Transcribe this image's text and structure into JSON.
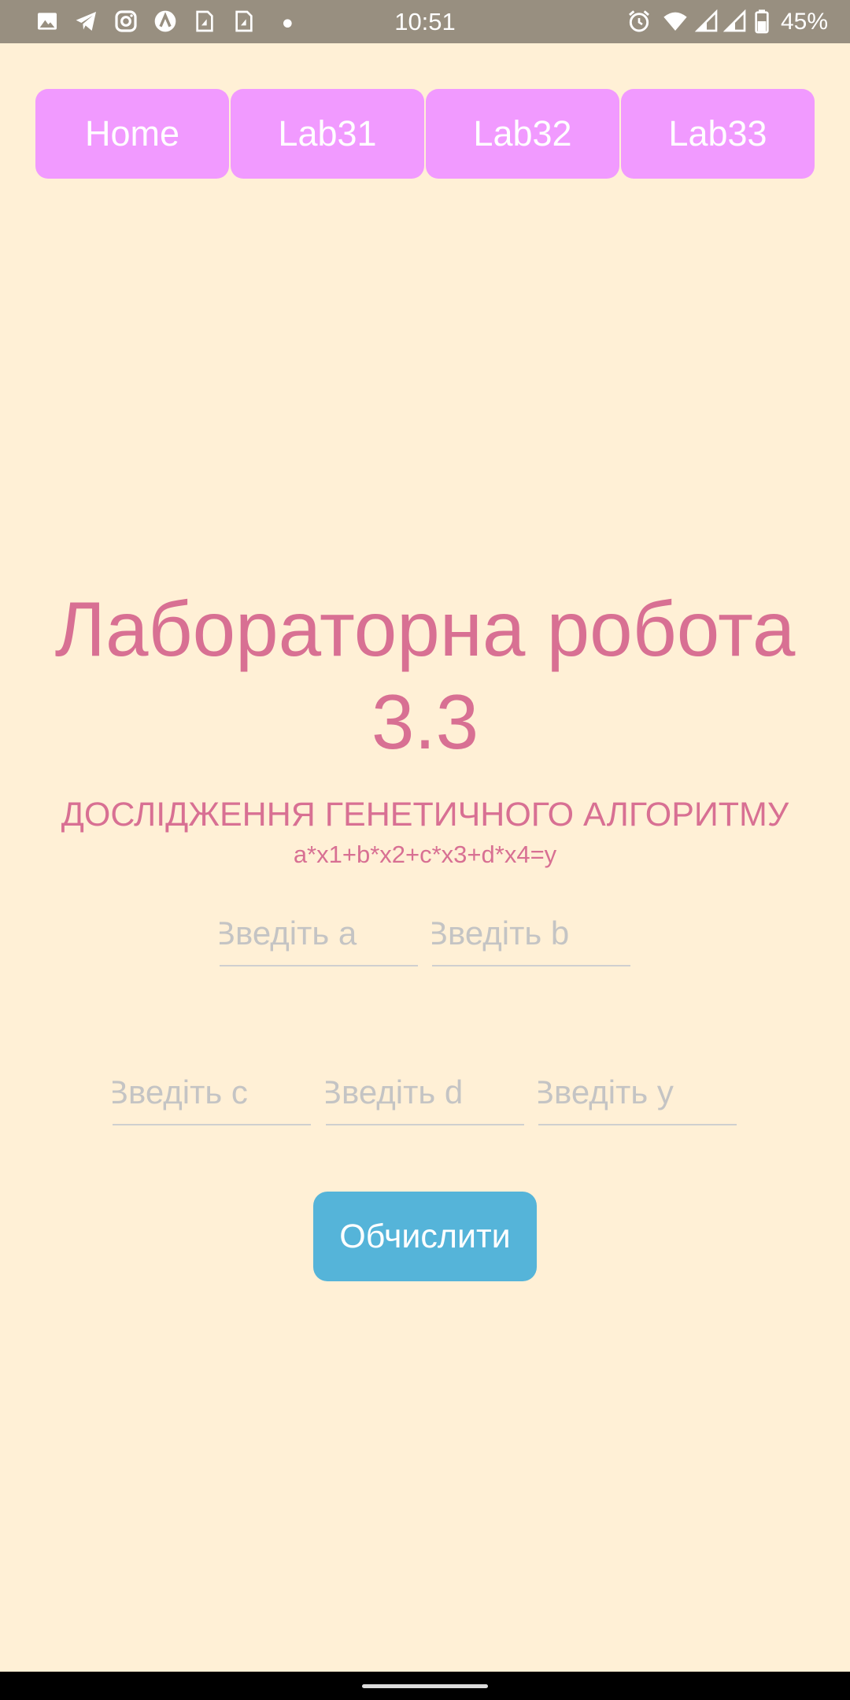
{
  "status_bar": {
    "time": "10:51",
    "battery": "45%",
    "left_icons": [
      "image-icon",
      "telegram-icon",
      "instagram-icon",
      "app-icon",
      "sim-card-icon",
      "sim-card-icon",
      "dot-icon"
    ],
    "right_icons": [
      "alarm-icon",
      "wifi-icon",
      "signal-icon",
      "signal-icon",
      "battery-icon"
    ]
  },
  "nav": {
    "tabs": [
      "Home",
      "Lab31",
      "Lab32",
      "Lab33"
    ]
  },
  "main": {
    "title_line1": "Лабораторна робота",
    "title_line2": "3.3",
    "subtitle": "ДОСЛІДЖЕННЯ ГЕНЕТИЧНОГО АЛГОРИТМУ",
    "formula": "a*x1+b*x2+c*x3+d*x4=y"
  },
  "inputs": {
    "a": {
      "value": "",
      "placeholder": "Введіть a"
    },
    "b": {
      "value": "",
      "placeholder": "Введіть b"
    },
    "c": {
      "value": "",
      "placeholder": "Введіть c"
    },
    "d": {
      "value": "",
      "placeholder": "Введіть d"
    },
    "y": {
      "value": "",
      "placeholder": "Введіть y"
    }
  },
  "calculate_button": "Обчислити",
  "colors": {
    "background": "#fff0d6",
    "status_bar": "#988f80",
    "tab": "#f19aff",
    "title": "#d87093",
    "button": "#55b4d9",
    "placeholder": "#c4c4c4"
  }
}
